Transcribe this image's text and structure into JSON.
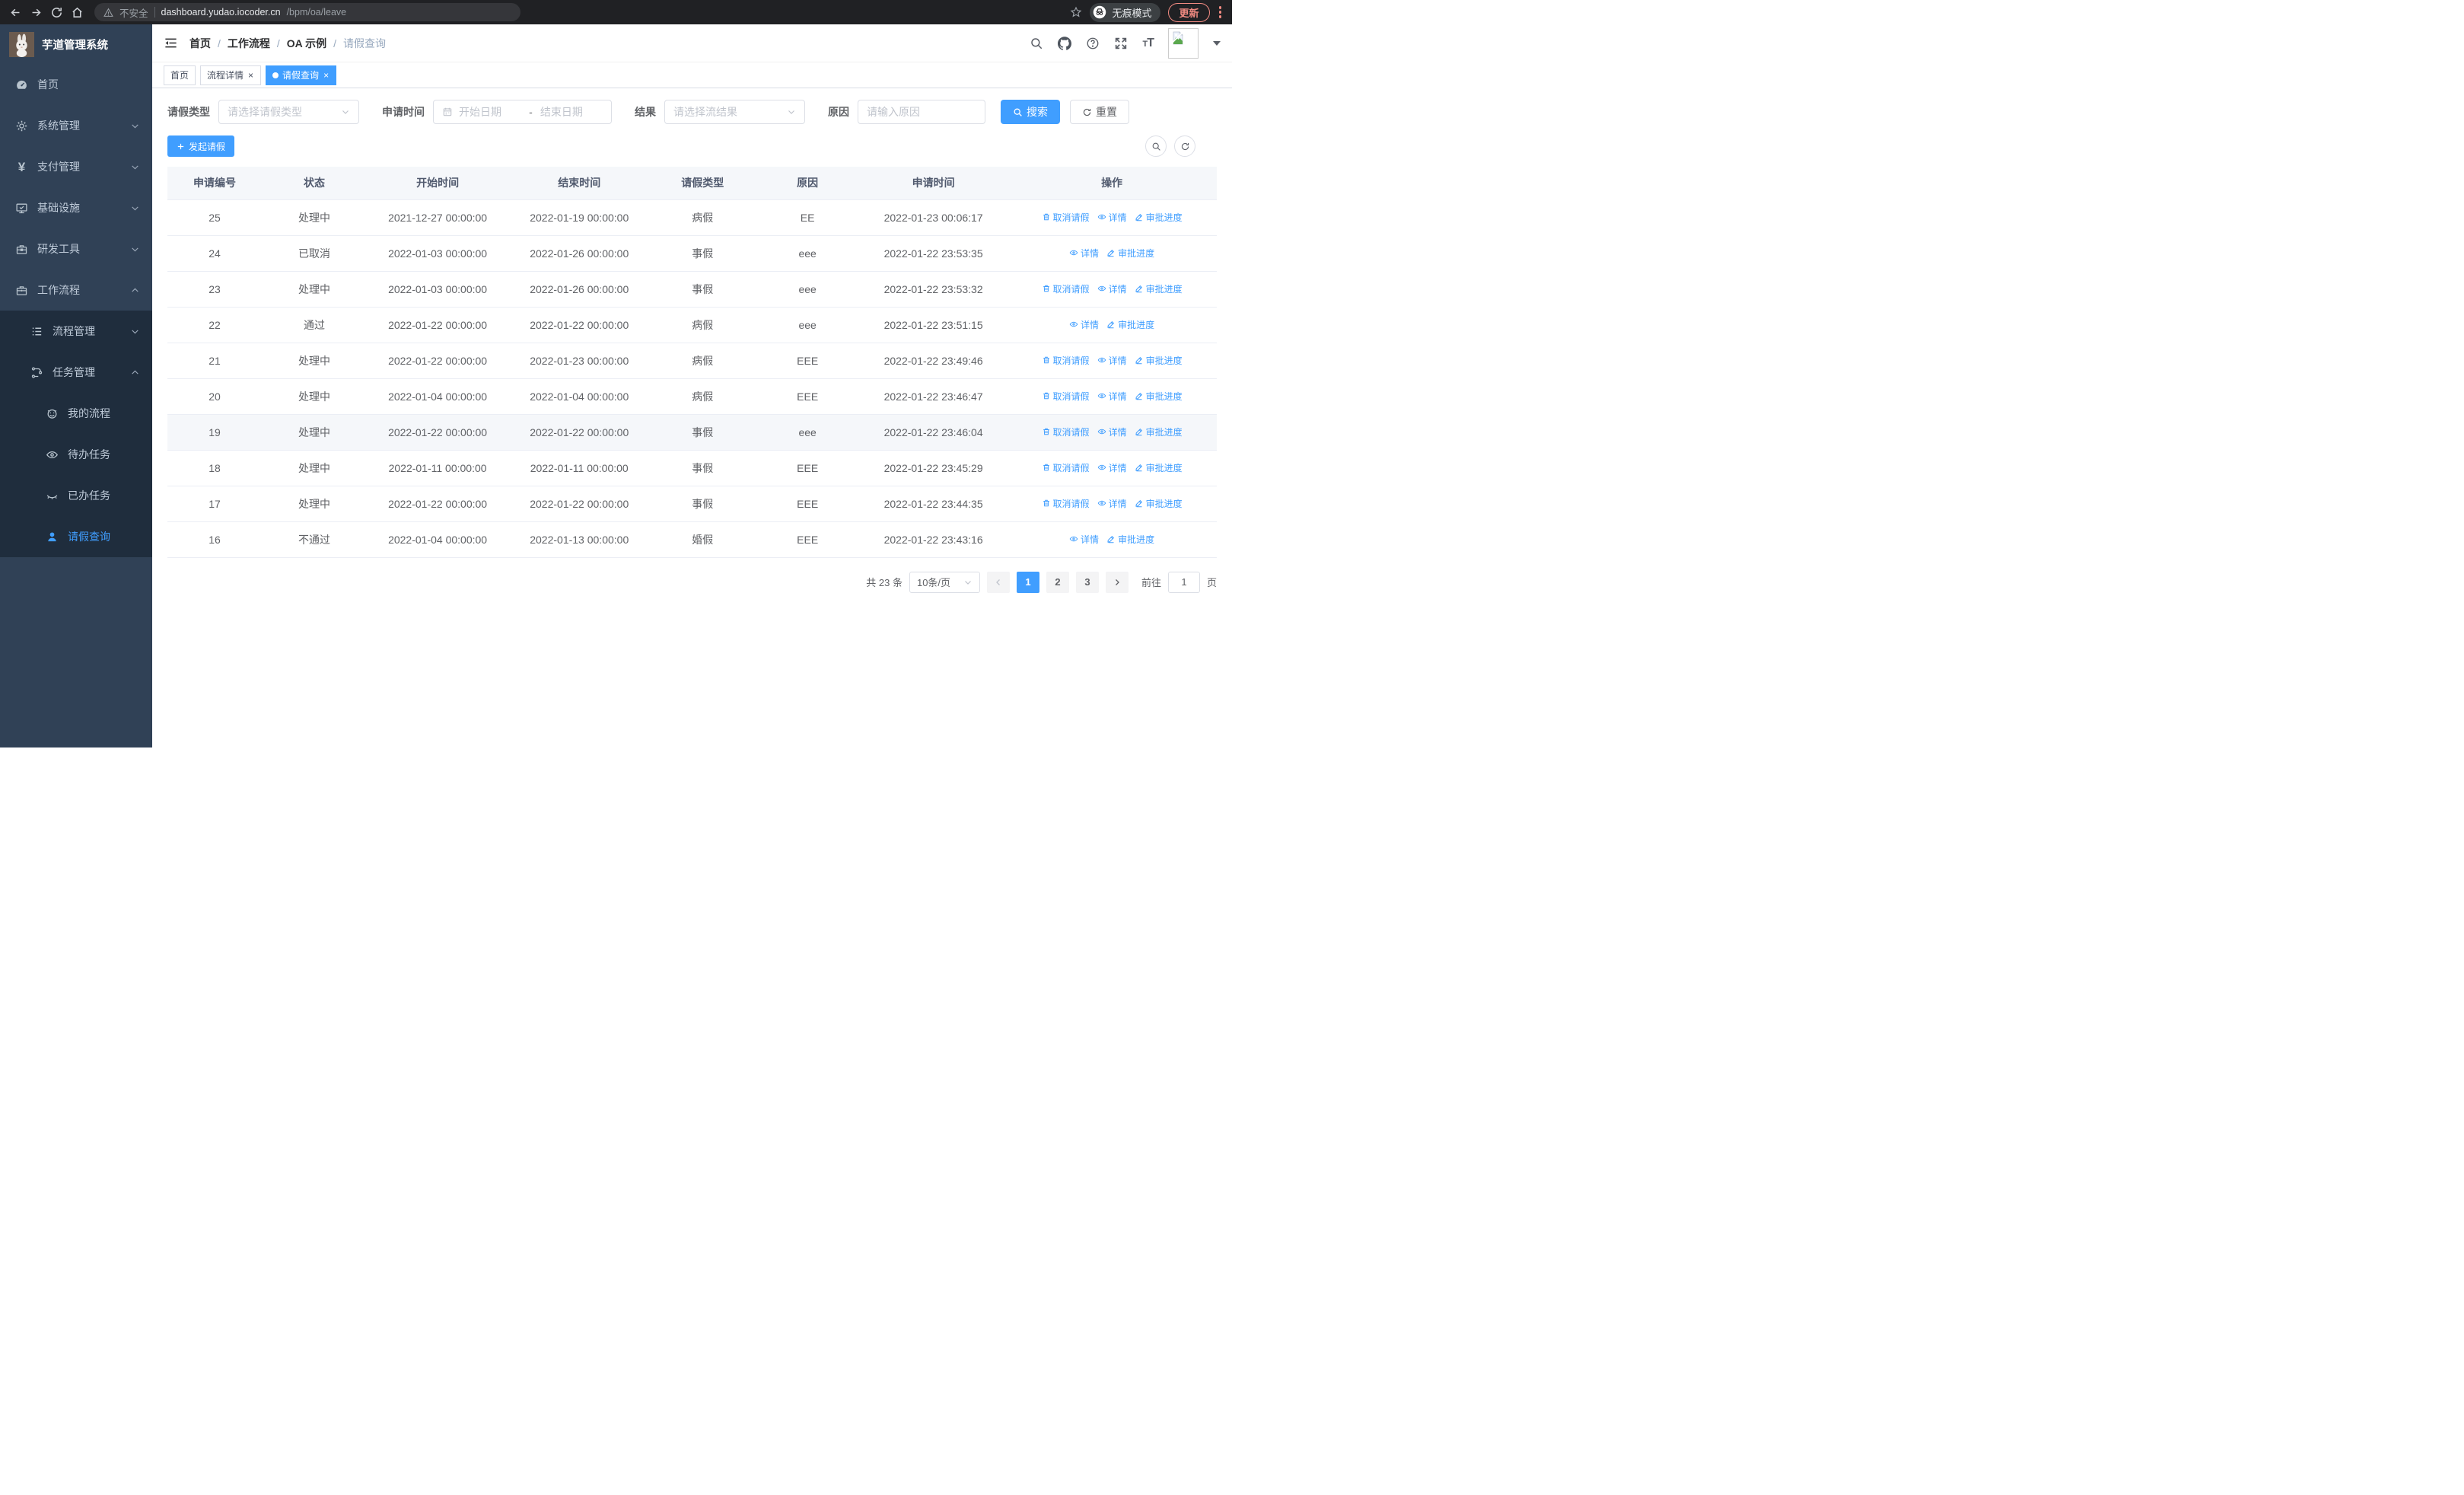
{
  "browser": {
    "security_label": "不安全",
    "url_host": "dashboard.yudao.iocoder.cn",
    "url_path": "/bpm/oa/leave",
    "incognito_label": "无痕模式",
    "update_label": "更新"
  },
  "sidebar": {
    "title": "芋道管理系统",
    "items": [
      {
        "label": "首页",
        "icon": "gauge-icon",
        "level": 1,
        "chevron": null,
        "sub": false,
        "active": false
      },
      {
        "label": "系统管理",
        "icon": "gear-icon",
        "level": 1,
        "chevron": "down",
        "sub": false,
        "active": false
      },
      {
        "label": "支付管理",
        "icon": "yen-icon",
        "level": 1,
        "chevron": "down",
        "sub": false,
        "active": false
      },
      {
        "label": "基础设施",
        "icon": "monitor-icon",
        "level": 1,
        "chevron": "down",
        "sub": false,
        "active": false
      },
      {
        "label": "研发工具",
        "icon": "toolbox-icon",
        "level": 1,
        "chevron": "down",
        "sub": false,
        "active": false
      },
      {
        "label": "工作流程",
        "icon": "briefcase-icon",
        "level": 1,
        "chevron": "up",
        "sub": false,
        "active": false
      },
      {
        "label": "流程管理",
        "icon": "list-icon",
        "level": 2,
        "chevron": "down",
        "sub": true,
        "active": false
      },
      {
        "label": "任务管理",
        "icon": "flow-icon",
        "level": 2,
        "chevron": "up",
        "sub": true,
        "active": false
      },
      {
        "label": "我的流程",
        "icon": "robot-icon",
        "level": 3,
        "chevron": null,
        "sub": true,
        "active": false
      },
      {
        "label": "待办任务",
        "icon": "eye-icon",
        "level": 3,
        "chevron": null,
        "sub": true,
        "active": false
      },
      {
        "label": "已办任务",
        "icon": "eye-closed-icon",
        "level": 3,
        "chevron": null,
        "sub": true,
        "active": false
      },
      {
        "label": "请假查询",
        "icon": "user-icon",
        "level": 3,
        "chevron": null,
        "sub": true,
        "active": true
      }
    ]
  },
  "header": {
    "breadcrumb": [
      "首页",
      "工作流程",
      "OA 示例",
      "请假查询"
    ],
    "tabs": [
      {
        "label": "首页",
        "closable": false,
        "active": false
      },
      {
        "label": "流程详情",
        "closable": true,
        "active": false
      },
      {
        "label": "请假查询",
        "closable": true,
        "active": true
      }
    ]
  },
  "filters": {
    "leave_type_label": "请假类型",
    "leave_type_placeholder": "请选择请假类型",
    "apply_time_label": "申请时间",
    "date_start_placeholder": "开始日期",
    "date_separator": "-",
    "date_end_placeholder": "结束日期",
    "result_label": "结果",
    "result_placeholder": "请选择流结果",
    "reason_label": "原因",
    "reason_placeholder": "请输入原因",
    "search_label": "搜索",
    "reset_label": "重置"
  },
  "toolbar": {
    "create_label": "发起请假"
  },
  "table": {
    "columns": [
      "申请编号",
      "状态",
      "开始时间",
      "结束时间",
      "请假类型",
      "原因",
      "申请时间",
      "操作"
    ],
    "action_labels": {
      "cancel": "取消请假",
      "detail": "详情",
      "progress": "审批进度"
    },
    "rows": [
      {
        "id": "25",
        "status": "处理中",
        "start": "2021-12-27 00:00:00",
        "end": "2022-01-19 00:00:00",
        "type": "病假",
        "reason": "EE",
        "applied": "2022-01-23 00:06:17",
        "cancelable": true,
        "highlighted": false
      },
      {
        "id": "24",
        "status": "已取消",
        "start": "2022-01-03 00:00:00",
        "end": "2022-01-26 00:00:00",
        "type": "事假",
        "reason": "eee",
        "applied": "2022-01-22 23:53:35",
        "cancelable": false,
        "highlighted": false
      },
      {
        "id": "23",
        "status": "处理中",
        "start": "2022-01-03 00:00:00",
        "end": "2022-01-26 00:00:00",
        "type": "事假",
        "reason": "eee",
        "applied": "2022-01-22 23:53:32",
        "cancelable": true,
        "highlighted": false
      },
      {
        "id": "22",
        "status": "通过",
        "start": "2022-01-22 00:00:00",
        "end": "2022-01-22 00:00:00",
        "type": "病假",
        "reason": "eee",
        "applied": "2022-01-22 23:51:15",
        "cancelable": false,
        "highlighted": false
      },
      {
        "id": "21",
        "status": "处理中",
        "start": "2022-01-22 00:00:00",
        "end": "2022-01-23 00:00:00",
        "type": "病假",
        "reason": "EEE",
        "applied": "2022-01-22 23:49:46",
        "cancelable": true,
        "highlighted": false
      },
      {
        "id": "20",
        "status": "处理中",
        "start": "2022-01-04 00:00:00",
        "end": "2022-01-04 00:00:00",
        "type": "病假",
        "reason": "EEE",
        "applied": "2022-01-22 23:46:47",
        "cancelable": true,
        "highlighted": false
      },
      {
        "id": "19",
        "status": "处理中",
        "start": "2022-01-22 00:00:00",
        "end": "2022-01-22 00:00:00",
        "type": "事假",
        "reason": "eee",
        "applied": "2022-01-22 23:46:04",
        "cancelable": true,
        "highlighted": true
      },
      {
        "id": "18",
        "status": "处理中",
        "start": "2022-01-11 00:00:00",
        "end": "2022-01-11 00:00:00",
        "type": "事假",
        "reason": "EEE",
        "applied": "2022-01-22 23:45:29",
        "cancelable": true,
        "highlighted": false
      },
      {
        "id": "17",
        "status": "处理中",
        "start": "2022-01-22 00:00:00",
        "end": "2022-01-22 00:00:00",
        "type": "事假",
        "reason": "EEE",
        "applied": "2022-01-22 23:44:35",
        "cancelable": true,
        "highlighted": false
      },
      {
        "id": "16",
        "status": "不通过",
        "start": "2022-01-04 00:00:00",
        "end": "2022-01-13 00:00:00",
        "type": "婚假",
        "reason": "EEE",
        "applied": "2022-01-22 23:43:16",
        "cancelable": false,
        "highlighted": false
      }
    ]
  },
  "pagination": {
    "total_label": "共 23 条",
    "page_size_label": "10条/页",
    "pages": [
      "1",
      "2",
      "3"
    ],
    "active_page": "1",
    "goto_label": "前往",
    "goto_value": "1",
    "goto_suffix": "页"
  },
  "colors": {
    "primary": "#409eff",
    "sidebar_bg": "#304156",
    "submenu_bg": "#1f2d3d",
    "update_accent": "#f28b82"
  }
}
